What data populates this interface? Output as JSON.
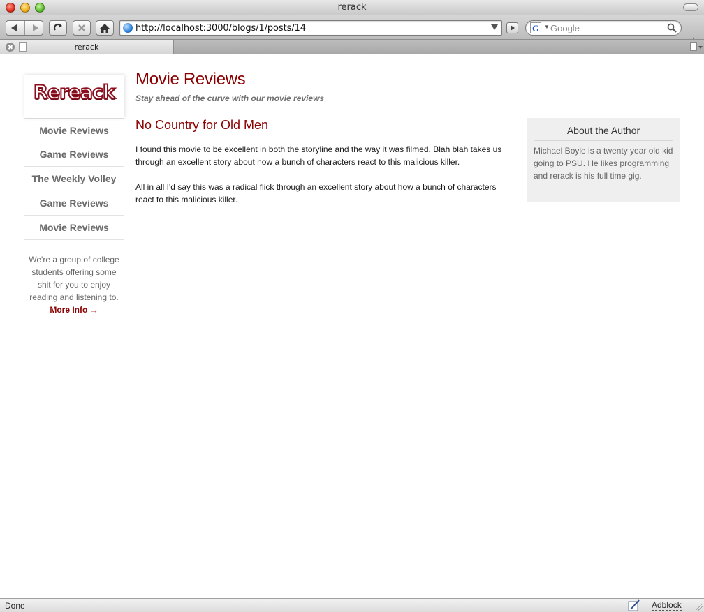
{
  "window": {
    "title": "rerack"
  },
  "toolbar": {
    "url": "http://localhost:3000/blogs/1/posts/14",
    "search_placeholder": "Google",
    "search_engine_letter": "G"
  },
  "tabs": [
    {
      "label": "rerack"
    }
  ],
  "sidebar": {
    "logo_text": "Rereack",
    "nav": [
      {
        "label": "Movie Reviews"
      },
      {
        "label": "Game Reviews"
      },
      {
        "label": "The Weekly Volley"
      },
      {
        "label": "Game Reviews"
      },
      {
        "label": "Movie Reviews"
      }
    ],
    "blurb": "We're a group of college students offering some shit for you to enjoy reading and listening to.",
    "more_link": "More Info →"
  },
  "main": {
    "title": "Movie Reviews",
    "tagline": "Stay ahead of the curve with our movie reviews"
  },
  "post": {
    "title": "No Country for Old Men",
    "paragraphs": [
      "I found this movie to be excellent in both the storyline and the way it was filmed. Blah blah takes us through an excellent story about how a bunch of characters react to this malicious killer.",
      "All in all I'd say this was a radical flick through an excellent story about how a bunch of characters react to this malicious killer."
    ]
  },
  "author_box": {
    "title": "About the Author",
    "text": "Michael Boyle is a twenty year old kid going to PSU. He likes programming and rerack is his full time gig."
  },
  "statusbar": {
    "status": "Done",
    "adblock_label": "Adblock"
  },
  "colors": {
    "accent": "#8b0000",
    "nav_text": "#6a6a6a",
    "author_bg": "#efefef"
  }
}
